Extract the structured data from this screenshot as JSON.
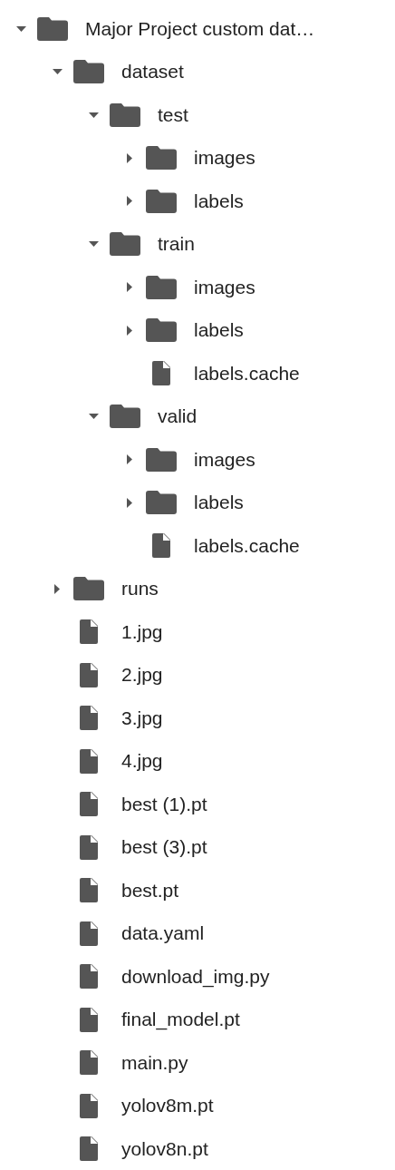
{
  "tree": [
    {
      "kind": "folder",
      "name": "Major Project custom dat…",
      "expanded": true,
      "children": [
        {
          "kind": "folder",
          "name": "dataset",
          "expanded": true,
          "children": [
            {
              "kind": "folder",
              "name": "test",
              "expanded": true,
              "children": [
                {
                  "kind": "folder",
                  "name": "images",
                  "expanded": false
                },
                {
                  "kind": "folder",
                  "name": "labels",
                  "expanded": false
                }
              ]
            },
            {
              "kind": "folder",
              "name": "train",
              "expanded": true,
              "children": [
                {
                  "kind": "folder",
                  "name": "images",
                  "expanded": false
                },
                {
                  "kind": "folder",
                  "name": "labels",
                  "expanded": false
                },
                {
                  "kind": "file",
                  "name": "labels.cache"
                }
              ]
            },
            {
              "kind": "folder",
              "name": "valid",
              "expanded": true,
              "children": [
                {
                  "kind": "folder",
                  "name": "images",
                  "expanded": false
                },
                {
                  "kind": "folder",
                  "name": "labels",
                  "expanded": false
                },
                {
                  "kind": "file",
                  "name": "labels.cache"
                }
              ]
            }
          ]
        },
        {
          "kind": "folder",
          "name": "runs",
          "expanded": false
        },
        {
          "kind": "file",
          "name": "1.jpg"
        },
        {
          "kind": "file",
          "name": "2.jpg"
        },
        {
          "kind": "file",
          "name": "3.jpg"
        },
        {
          "kind": "file",
          "name": "4.jpg"
        },
        {
          "kind": "file",
          "name": "best (1).pt"
        },
        {
          "kind": "file",
          "name": "best (3).pt"
        },
        {
          "kind": "file",
          "name": "best.pt"
        },
        {
          "kind": "file",
          "name": "data.yaml"
        },
        {
          "kind": "file",
          "name": "download_img.py"
        },
        {
          "kind": "file",
          "name": "final_model.pt"
        },
        {
          "kind": "file",
          "name": "main.py"
        },
        {
          "kind": "file",
          "name": "yolov8m.pt"
        },
        {
          "kind": "file",
          "name": "yolov8n.pt"
        }
      ]
    }
  ]
}
